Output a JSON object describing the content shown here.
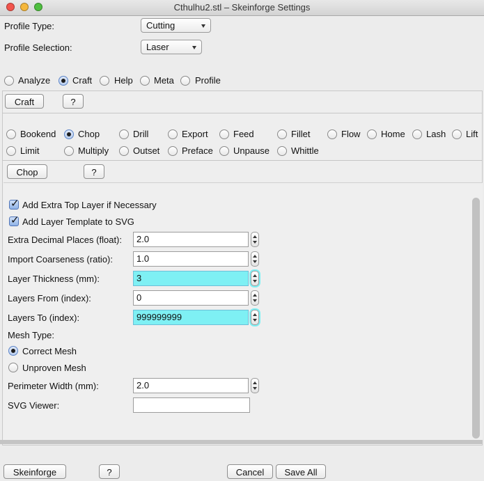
{
  "window": {
    "title": "Cthulhu2.stl – Skeinforge Settings"
  },
  "profile": {
    "type_label": "Profile Type:",
    "type_value": "Cutting",
    "selection_label": "Profile Selection:",
    "selection_value": "Laser"
  },
  "top_tabs": [
    {
      "label": "Analyze",
      "selected": false
    },
    {
      "label": "Craft",
      "selected": true
    },
    {
      "label": "Help",
      "selected": false
    },
    {
      "label": "Meta",
      "selected": false
    },
    {
      "label": "Profile",
      "selected": false
    }
  ],
  "craft_bar": {
    "craft_label": "Craft",
    "help_label": "?"
  },
  "plugins_row1": [
    "Bookend",
    "Chop",
    "Drill",
    "Export",
    "Feed",
    "Fillet",
    "Flow",
    "Home",
    "Lash",
    "Lift"
  ],
  "plugins_row2": [
    "Limit",
    "Multiply",
    "Outset",
    "Preface",
    "Unpause",
    "Whittle"
  ],
  "selected_plugin": "Chop",
  "chop_bar": {
    "chop_label": "Chop",
    "help_label": "?"
  },
  "settings": {
    "add_extra_top_layer": {
      "label": "Add Extra Top Layer if Necessary",
      "checked": true
    },
    "add_layer_template": {
      "label": "Add Layer Template to SVG",
      "checked": true
    },
    "extra_decimal_places": {
      "label": "Extra Decimal Places (float):",
      "value": "2.0"
    },
    "import_coarseness": {
      "label": "Import Coarseness (ratio):",
      "value": "1.0"
    },
    "layer_thickness": {
      "label": "Layer Thickness (mm):",
      "value": "3"
    },
    "layers_from": {
      "label": "Layers From (index):",
      "value": "0"
    },
    "layers_to": {
      "label": "Layers To (index):",
      "value": "999999999"
    },
    "mesh_type_label": "Mesh Type:",
    "correct_mesh": {
      "label": "Correct Mesh",
      "selected": true
    },
    "unproven_mesh": {
      "label": "Unproven Mesh",
      "selected": false
    },
    "perimeter_width": {
      "label": "Perimeter Width (mm):",
      "value": "2.0"
    },
    "svg_viewer": {
      "label": "SVG Viewer:",
      "value": ""
    }
  },
  "footer": {
    "skeinforge_label": "Skeinforge",
    "help_label": "?",
    "cancel_label": "Cancel",
    "save_all_label": "Save All"
  },
  "colors": {
    "highlight_field": "#7ef0f4",
    "selection_blue": "#5b84c8"
  }
}
